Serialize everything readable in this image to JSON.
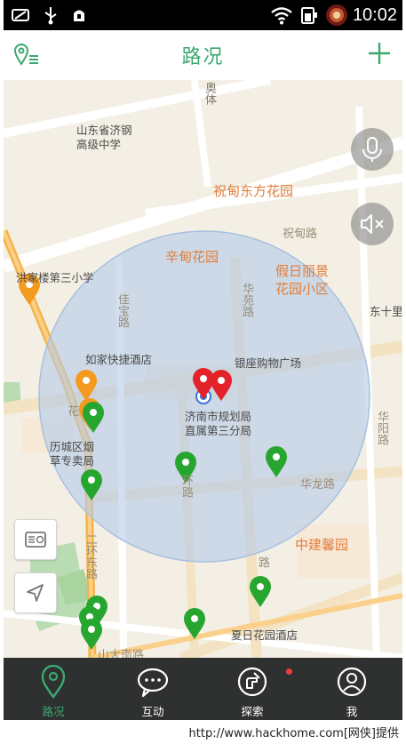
{
  "status_bar": {
    "time": "10:02",
    "icons": [
      "screenshot-icon",
      "usb-icon",
      "android-debug-icon",
      "wifi-icon",
      "battery-icon",
      "app-badge-icon"
    ]
  },
  "header": {
    "title": "路况",
    "left_icon": "location-list-icon",
    "right_icon": "add-icon"
  },
  "map": {
    "range_circle_color": "#b7cce6",
    "pin_green": "#27a62f",
    "pin_orange": "#f39a1f",
    "pin_red": "#e3222a",
    "labels": {
      "poi_1": "山东省济钢",
      "poi_2": "高级中学",
      "area_zhudian_east": "祝甸东方花园",
      "road_zhudian": "祝甸路",
      "area_xindian": "辛甸花园",
      "area_jiari_1": "假日丽景",
      "area_jiari_2": "花园小区",
      "poi_xiaoxue": "洪家楼第三小学",
      "road_jiabao": "佳宝路",
      "road_huayuan": "华苑路",
      "road_dongshili": "东十里",
      "poi_rujia": "如家快捷酒店",
      "poi_yinzuo": "银座购物广场",
      "poi_guihua_1": "济南市规划局",
      "poi_guihua_2": "直属第三分局",
      "poi_yancao_1": "历城区烟",
      "poi_yancao_2": "草专卖局",
      "road_hualong": "华龙路",
      "road_huayang": "华阳路",
      "road_erhuan": "二环东路",
      "area_zhongjian": "中建馨园",
      "poi_xiari": "夏日花园酒店",
      "road_shanda": "山大南路",
      "road_top_vertical": "奥体",
      "road_hua_short": "花",
      "road_kanqi": "环路",
      "road_pindong": "路"
    }
  },
  "map_controls": {
    "radio_button_icon": "radio-icon",
    "locate_button_icon": "locate-arrow-icon",
    "voice_button_icon": "microphone-icon",
    "mute_button_icon": "mute-speaker-icon"
  },
  "tabs": [
    {
      "label": "路况",
      "icon": "map-pin-tab-icon",
      "active": true
    },
    {
      "label": "互动",
      "icon": "chat-bubbles-icon",
      "active": false
    },
    {
      "label": "探索",
      "icon": "explore-hand-icon",
      "active": false,
      "badge": true
    },
    {
      "label": "我",
      "icon": "user-profile-icon",
      "active": false
    }
  ],
  "watermark": "http://www.hackhome.com[网侠]提供"
}
